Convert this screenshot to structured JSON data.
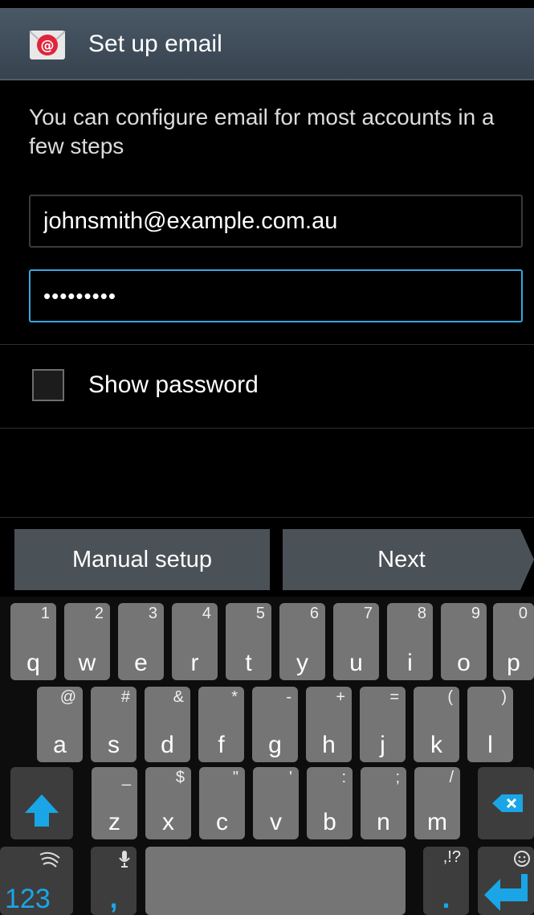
{
  "header": {
    "title": "Set up email",
    "icon": "email-app-icon"
  },
  "intro_text": "You can configure email for most accounts in a few steps",
  "form": {
    "email_value": "johnsmith@example.com.au",
    "password_value": "•••••••••",
    "show_password_label": "Show password"
  },
  "buttons": {
    "manual_setup": "Manual setup",
    "next": "Next"
  },
  "keyboard": {
    "row1": [
      {
        "main": "q",
        "alt": "1"
      },
      {
        "main": "w",
        "alt": "2"
      },
      {
        "main": "e",
        "alt": "3"
      },
      {
        "main": "r",
        "alt": "4"
      },
      {
        "main": "t",
        "alt": "5"
      },
      {
        "main": "y",
        "alt": "6"
      },
      {
        "main": "u",
        "alt": "7"
      },
      {
        "main": "i",
        "alt": "8"
      },
      {
        "main": "o",
        "alt": "9"
      },
      {
        "main": "p",
        "alt": "0"
      }
    ],
    "row2": [
      {
        "main": "a",
        "alt": "@"
      },
      {
        "main": "s",
        "alt": "#"
      },
      {
        "main": "d",
        "alt": "&"
      },
      {
        "main": "f",
        "alt": "*"
      },
      {
        "main": "g",
        "alt": "-"
      },
      {
        "main": "h",
        "alt": "+"
      },
      {
        "main": "j",
        "alt": "="
      },
      {
        "main": "k",
        "alt": "("
      },
      {
        "main": "l",
        "alt": ")"
      }
    ],
    "row3": [
      {
        "main": "z",
        "alt": "_"
      },
      {
        "main": "x",
        "alt": "$"
      },
      {
        "main": "c",
        "alt": "\""
      },
      {
        "main": "v",
        "alt": "'"
      },
      {
        "main": "b",
        "alt": ":"
      },
      {
        "main": "n",
        "alt": ";"
      },
      {
        "main": "m",
        "alt": "/"
      }
    ],
    "num_key": "123",
    "comma_key": ",",
    "period_key": ".",
    "punct_alt": ",!?",
    "accent_color": "#1aa6e6"
  }
}
